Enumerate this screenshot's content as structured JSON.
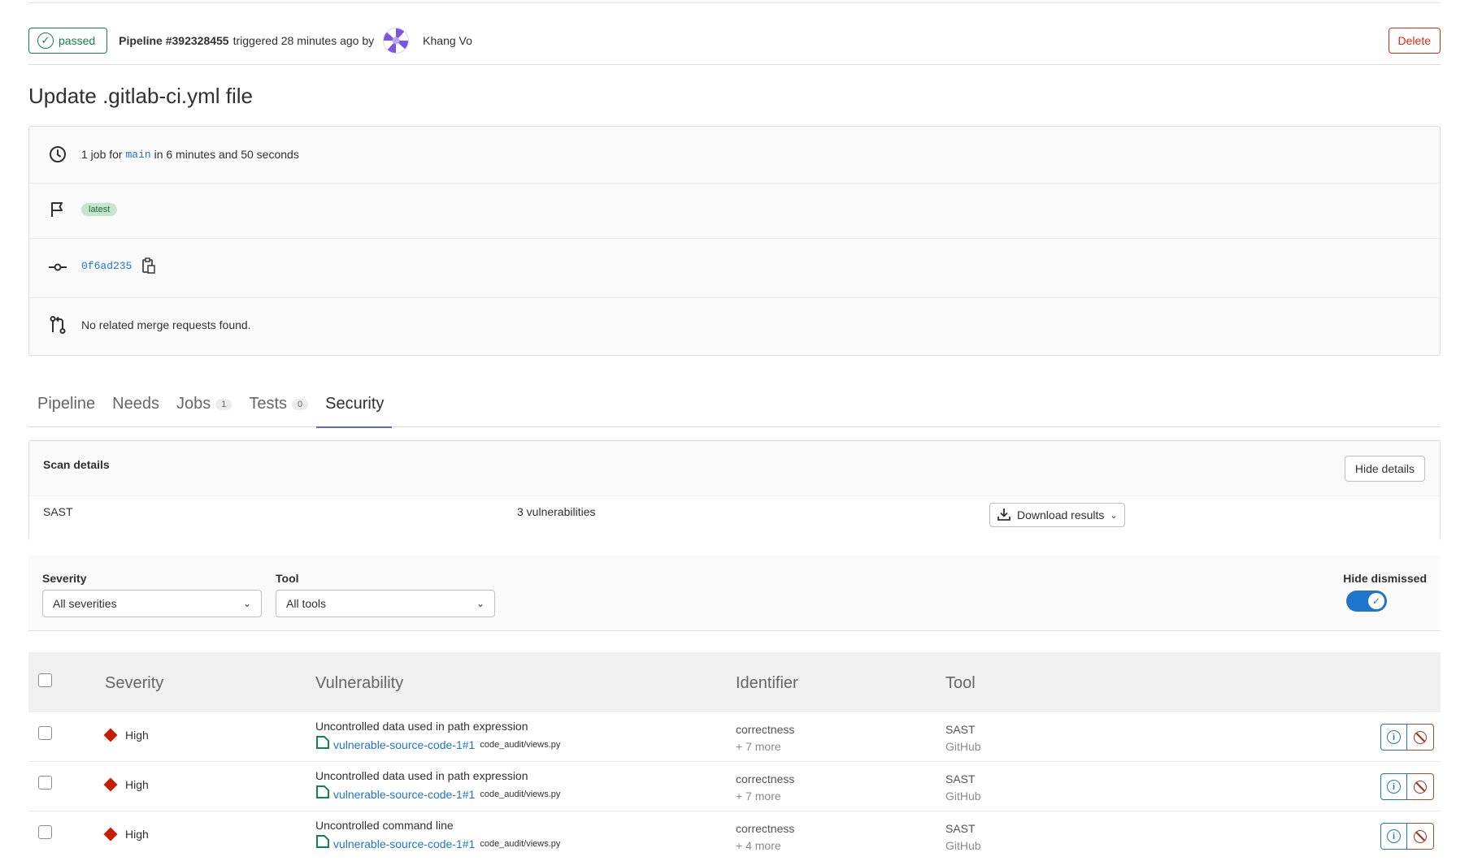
{
  "header": {
    "status": "passed",
    "pipeline_label": "Pipeline #392328455",
    "triggered_text": "triggered 28 minutes ago by",
    "user_name": "Khang Vo",
    "delete_label": "Delete"
  },
  "title": "Update .gitlab-ci.yml file",
  "info": {
    "jobs_prefix": "1 job for",
    "branch": "main",
    "duration": "in 6 minutes and 50 seconds",
    "tag": "latest",
    "commit": "0f6ad235",
    "merge_requests": "No related merge requests found."
  },
  "tabs": [
    {
      "label": "Pipeline",
      "count": null
    },
    {
      "label": "Needs",
      "count": null
    },
    {
      "label": "Jobs",
      "count": "1"
    },
    {
      "label": "Tests",
      "count": "0"
    },
    {
      "label": "Security",
      "count": null,
      "active": true
    }
  ],
  "scan": {
    "title": "Scan details",
    "hide_label": "Hide details",
    "tool": "SAST",
    "vulnerabilities": "3 vulnerabilities",
    "download_label": "Download results"
  },
  "filters": {
    "severity_label": "Severity",
    "severity_value": "All severities",
    "tool_label": "Tool",
    "tool_value": "All tools",
    "hide_dismissed_label": "Hide dismissed",
    "hide_dismissed_on": true
  },
  "table": {
    "columns": [
      "Severity",
      "Vulnerability",
      "Identifier",
      "Tool"
    ],
    "rows": [
      {
        "severity": "High",
        "title": "Uncontrolled data used in path expression",
        "link": "vulnerable-source-code-1#1",
        "path": "code_audit/views.py",
        "identifier": "correctness",
        "more": "+ 7 more",
        "tool": "SAST",
        "scanner": "GitHub"
      },
      {
        "severity": "High",
        "title": "Uncontrolled data used in path expression",
        "link": "vulnerable-source-code-1#1",
        "path": "code_audit/views.py",
        "identifier": "correctness",
        "more": "+ 7 more",
        "tool": "SAST",
        "scanner": "GitHub"
      },
      {
        "severity": "High",
        "title": "Uncontrolled command line",
        "link": "vulnerable-source-code-1#1",
        "path": "code_audit/views.py",
        "identifier": "correctness",
        "more": "+ 4 more",
        "tool": "SAST",
        "scanner": "GitHub"
      }
    ]
  },
  "colors": {
    "success": "#108548",
    "danger": "#dd2b0e",
    "link": "#1f75cb",
    "severity_high": "#c91c00",
    "tab_active": "#6666c4"
  }
}
